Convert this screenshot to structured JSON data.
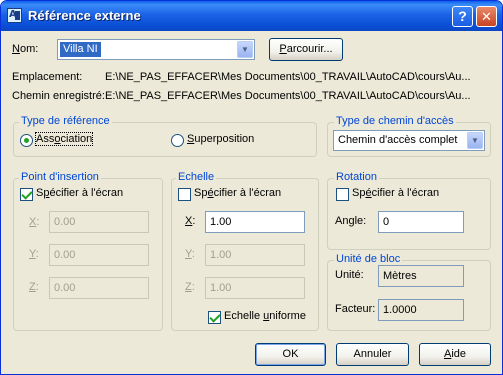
{
  "window": {
    "title": "Référence externe",
    "help_glyph": "?",
    "close_glyph": "✕"
  },
  "name": {
    "label_u": "N",
    "label_rest": "om:",
    "value": "Villa NI",
    "browse_u": "P",
    "browse_rest": "arcourir..."
  },
  "paths": {
    "location_label": "Emplacement:",
    "location_value": "E:\\NE_PAS_EFFACER\\Mes Documents\\00_TRAVAIL\\AutoCAD\\cours\\Au...",
    "saved_label": "Chemin enregistré:",
    "saved_value": "E:\\NE_PAS_EFFACER\\Mes Documents\\00_TRAVAIL\\AutoCAD\\cours\\Au..."
  },
  "ref_type": {
    "legend": "Type de référence",
    "attach_pre": "Ass",
    "attach_u": "o",
    "attach_post": "ciation",
    "overlay_u": "S",
    "overlay_rest": "uperposition",
    "selected": "Association"
  },
  "path_type": {
    "legend": "Type de chemin d'accès",
    "value": "Chemin d'accès complet"
  },
  "insertion": {
    "legend": "Point d'insertion",
    "specify_pre": "S",
    "specify_u": "p",
    "specify_post": "écifier à l'écran",
    "specify_checked": true,
    "x_label": "X",
    "y_label": "Y",
    "z_label": "Z",
    "x": "0.00",
    "y": "0.00",
    "z": "0.00"
  },
  "scale": {
    "legend": "Echelle",
    "specify_pre": "Sp",
    "specify_u": "é",
    "specify_post": "cifier à l'écran",
    "specify_checked": false,
    "x_label": "X",
    "y_label": "Y",
    "z_label": "Z",
    "x": "1.00",
    "y": "1.00",
    "z": "1.00",
    "uniform_pre": "Echelle ",
    "uniform_u": "u",
    "uniform_post": "niforme",
    "uniform_checked": true
  },
  "rotation": {
    "legend": "Rotation",
    "specify_pre": "Sp",
    "specify_u": "é",
    "specify_post": "cifier à l'écran",
    "specify_checked": false,
    "angle_label": "Angle:",
    "angle": "0"
  },
  "block_unit": {
    "legend": "Unité de bloc",
    "unit_label": "Unité:",
    "unit_value": "Mètres",
    "factor_label": "Facteur:",
    "factor_value": "1.0000"
  },
  "buttons": {
    "ok": "OK",
    "cancel": "Annuler",
    "help_u": "A",
    "help_rest": "ide"
  }
}
